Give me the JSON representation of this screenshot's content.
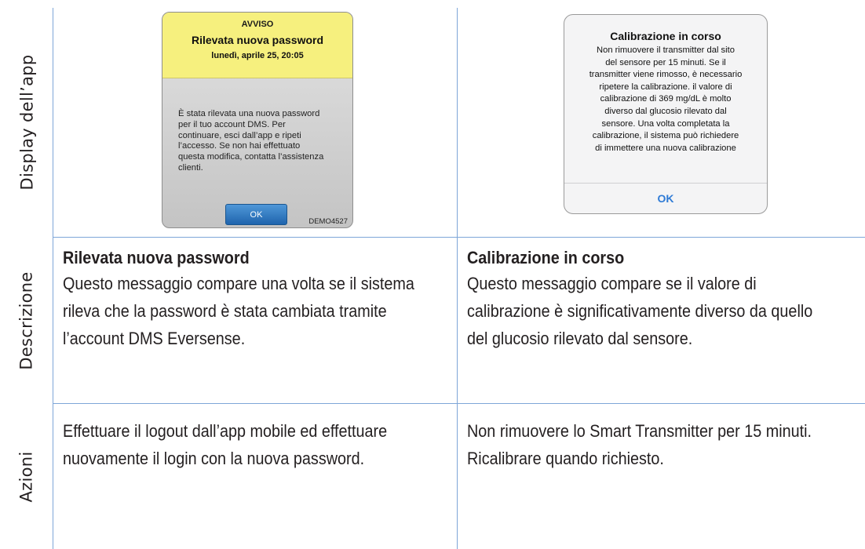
{
  "row_labels": {
    "display": "Display dell’app",
    "descrizione": "Descrizione",
    "azioni": "Azioni"
  },
  "dialog1": {
    "header_label": "AVVISO",
    "title": "Rilevata nuova password",
    "datetime": "lunedì, aprile 25, 20:05",
    "message_lines": [
      "È stata rilevata una nuova password",
      "per il tuo account DMS. Per",
      "continuare, esci dall’app e ripeti",
      "l’accesso. Se non hai effettuato",
      "questa modifica, contatta l’assistenza",
      "clienti."
    ],
    "ok_label": "OK",
    "code": "DEMO4527"
  },
  "dialog2": {
    "title": "Calibrazione in corso",
    "message_lines": [
      "Non rimuovere il transmitter dal sito",
      "del sensore per 15 minuti. Se il",
      "transmitter viene rimosso, è necessario",
      "ripetere la calibrazione. il valore di",
      "calibrazione di 369 mg/dL è molto",
      "diverso dal glucosio rilevato dal",
      "sensore. Una volta completata la",
      "calibrazione, il sistema può richiedere",
      "di immettere una nuova calibrazione"
    ],
    "ok_label": "OK"
  },
  "descrizione": {
    "left": {
      "title": "Rilevata nuova password",
      "lines": [
        "Questo messaggio compare una volta se il sistema",
        "rileva che la password è stata cambiata tramite",
        "l’account DMS Eversense."
      ]
    },
    "right": {
      "title": "Calibrazione in corso",
      "lines": [
        "Questo messaggio compare se il valore di",
        "calibrazione è significativamente diverso da quello",
        "del glucosio rilevato dal sensore."
      ]
    }
  },
  "azioni": {
    "left": {
      "lines": [
        "Effettuare il logout dall’app mobile ed effettuare",
        "nuovamente il login con la nuova password."
      ]
    },
    "right": {
      "lines": [
        "Non rimuovere lo Smart Transmitter per 15 minuti.",
        "Ricalibrare quando richiesto."
      ]
    }
  }
}
